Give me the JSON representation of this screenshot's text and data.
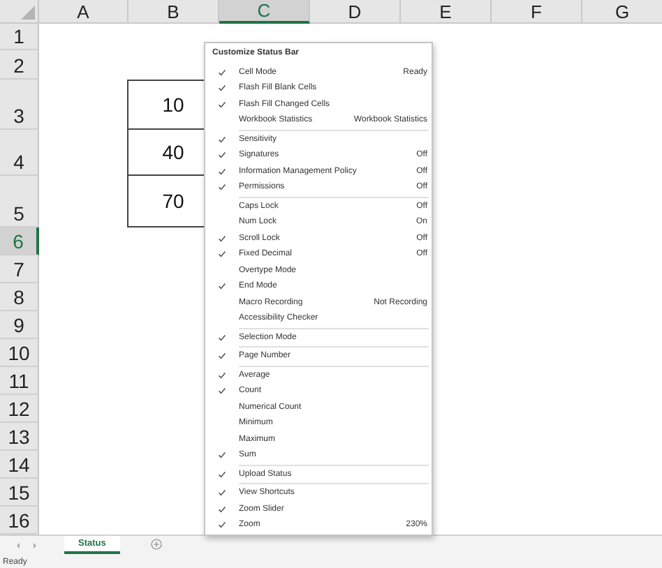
{
  "columns": [
    {
      "label": "A",
      "selected": false
    },
    {
      "label": "B",
      "selected": false
    },
    {
      "label": "C",
      "selected": true
    },
    {
      "label": "D",
      "selected": false
    },
    {
      "label": "E",
      "selected": false
    },
    {
      "label": "F",
      "selected": false
    },
    {
      "label": "G",
      "selected": false
    }
  ],
  "rows": [
    {
      "label": "1",
      "selected": false
    },
    {
      "label": "2",
      "selected": false
    },
    {
      "label": "3",
      "selected": false,
      "column_b": "10"
    },
    {
      "label": "4",
      "selected": false,
      "column_b": "40"
    },
    {
      "label": "5",
      "selected": false,
      "column_b": "70"
    },
    {
      "label": "6",
      "selected": true
    },
    {
      "label": "7",
      "selected": false
    },
    {
      "label": "8",
      "selected": false
    },
    {
      "label": "9",
      "selected": false
    },
    {
      "label": "10",
      "selected": false
    },
    {
      "label": "11",
      "selected": false
    },
    {
      "label": "12",
      "selected": false
    },
    {
      "label": "13",
      "selected": false
    },
    {
      "label": "14",
      "selected": false
    },
    {
      "label": "15",
      "selected": false
    },
    {
      "label": "16",
      "selected": false
    }
  ],
  "sheet_tabs": [
    {
      "label": "Status",
      "selected": true
    }
  ],
  "status_bar": {
    "text": "Ready"
  },
  "menu": {
    "title": "Customize Status Bar",
    "groups": [
      [
        {
          "label": "Cell Mode",
          "checked": true,
          "value": "Ready"
        },
        {
          "label": "Flash Fill Blank Cells",
          "checked": true
        },
        {
          "label": "Flash Fill Changed Cells",
          "checked": true
        },
        {
          "label": "Workbook Statistics",
          "checked": false,
          "value": "Workbook Statistics"
        }
      ],
      [
        {
          "label": "Sensitivity",
          "checked": true
        },
        {
          "label": "Signatures",
          "checked": true,
          "value": "Off"
        },
        {
          "label": "Information Management Policy",
          "checked": true,
          "value": "Off"
        },
        {
          "label": "Permissions",
          "checked": true,
          "value": "Off"
        }
      ],
      [
        {
          "label": "Caps Lock",
          "checked": false,
          "value": "Off"
        },
        {
          "label": "Num Lock",
          "checked": false,
          "value": "On"
        },
        {
          "label": "Scroll Lock",
          "checked": true,
          "value": "Off"
        },
        {
          "label": "Fixed Decimal",
          "checked": true,
          "value": "Off"
        },
        {
          "label": "Overtype Mode",
          "checked": false
        },
        {
          "label": "End Mode",
          "checked": true
        },
        {
          "label": "Macro Recording",
          "checked": false,
          "value": "Not Recording"
        },
        {
          "label": "Accessibility Checker",
          "checked": false
        }
      ],
      [
        {
          "label": "Selection Mode",
          "checked": true
        }
      ],
      [
        {
          "label": "Page Number",
          "checked": true
        }
      ],
      [
        {
          "label": "Average",
          "checked": true
        },
        {
          "label": "Count",
          "checked": true
        },
        {
          "label": "Numerical Count",
          "checked": false
        },
        {
          "label": "Minimum",
          "checked": false
        },
        {
          "label": "Maximum",
          "checked": false
        },
        {
          "label": "Sum",
          "checked": true
        }
      ],
      [
        {
          "label": "Upload Status",
          "checked": true
        }
      ],
      [
        {
          "label": "View Shortcuts",
          "checked": true
        },
        {
          "label": "Zoom Slider",
          "checked": true
        },
        {
          "label": "Zoom",
          "checked": true,
          "value": "230%"
        }
      ]
    ]
  }
}
